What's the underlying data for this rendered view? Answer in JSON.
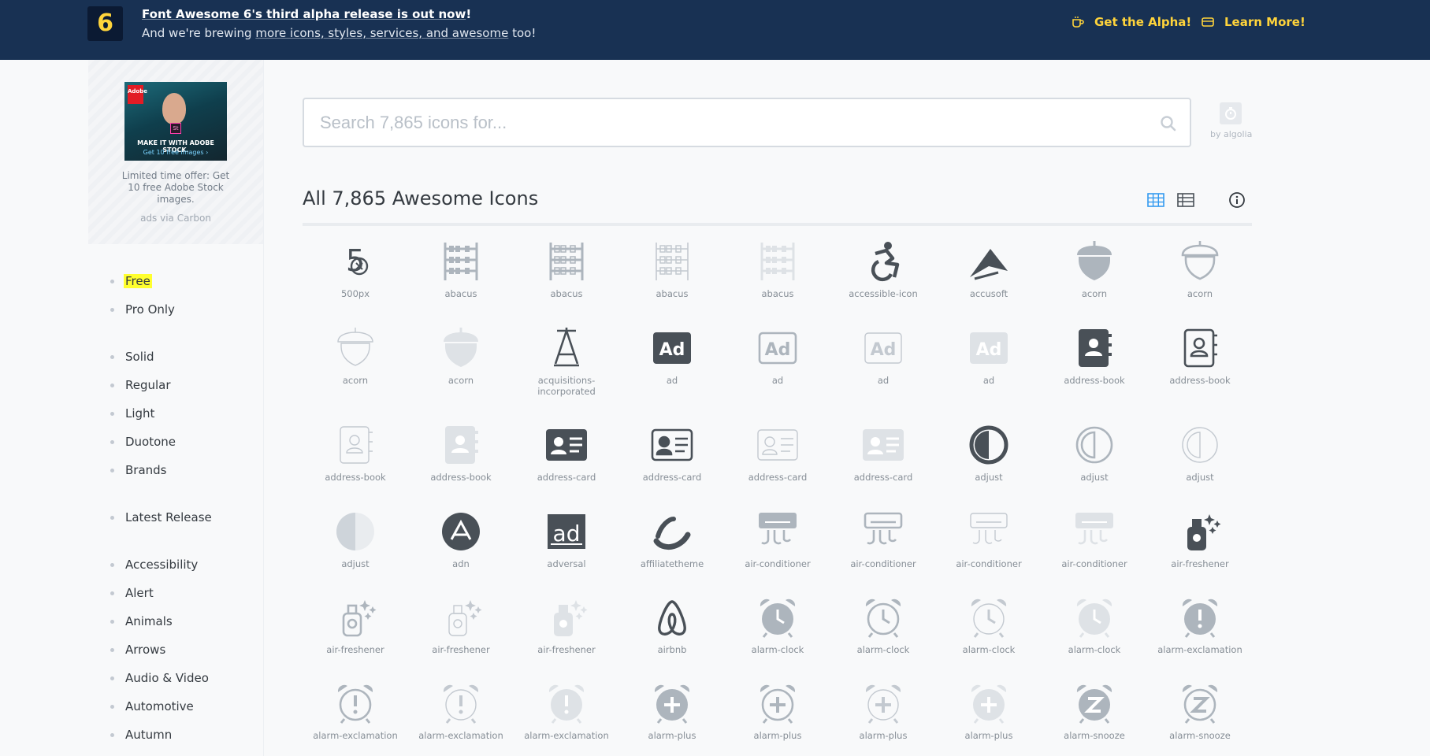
{
  "banner": {
    "logo": "6",
    "headline_link": "Font Awesome 6's third alpha release is out now",
    "headline_end": "!",
    "sub_before": "And we're brewing ",
    "sub_link": "more icons, styles, services, and awesome",
    "sub_after": " too!",
    "get_alpha": "Get the Alpha!",
    "learn_more": "Learn More!",
    "accent": "#ffd43b",
    "bg": "#183153"
  },
  "ad": {
    "image_brand": "Adobe",
    "image_caption": "MAKE IT WITH ADOBE STOCK.",
    "image_cta": "Get 10 free images ›",
    "image_badge": "St",
    "text": "Limited time offer: Get 10 free Adobe Stock images.",
    "via": "ads via Carbon"
  },
  "filters": [
    {
      "label": "Free",
      "highlight": true
    },
    {
      "label": "Pro Only"
    },
    {
      "label": "Solid"
    },
    {
      "label": "Regular"
    },
    {
      "label": "Light"
    },
    {
      "label": "Duotone"
    },
    {
      "label": "Brands"
    },
    {
      "label": "Latest Release"
    },
    {
      "label": "Accessibility"
    },
    {
      "label": "Alert"
    },
    {
      "label": "Animals"
    },
    {
      "label": "Arrows"
    },
    {
      "label": "Audio & Video"
    },
    {
      "label": "Automotive"
    },
    {
      "label": "Autumn"
    }
  ],
  "search": {
    "placeholder": "Search 7,865 icons for...",
    "value": "",
    "algolia": "by algolia"
  },
  "heading": "All 7,865 Awesome Icons",
  "icons": [
    {
      "name": "500px",
      "shape": "fivehundred",
      "style": "brand"
    },
    {
      "name": "abacus",
      "shape": "abacus",
      "style": "solid"
    },
    {
      "name": "abacus",
      "shape": "abacus",
      "style": "regular"
    },
    {
      "name": "abacus",
      "shape": "abacus",
      "style": "light"
    },
    {
      "name": "abacus",
      "shape": "abacus",
      "style": "duotone"
    },
    {
      "name": "accessible-icon",
      "shape": "accessible",
      "style": "brand"
    },
    {
      "name": "accusoft",
      "shape": "accusoft",
      "style": "brand"
    },
    {
      "name": "acorn",
      "shape": "acorn",
      "style": "solid"
    },
    {
      "name": "acorn",
      "shape": "acorn",
      "style": "regular"
    },
    {
      "name": "acorn",
      "shape": "acorn",
      "style": "light"
    },
    {
      "name": "acorn",
      "shape": "acorn",
      "style": "duotone"
    },
    {
      "name": "acquisitions-incorporated",
      "shape": "acquisitions",
      "style": "brand"
    },
    {
      "name": "ad",
      "shape": "ad",
      "style": "brand"
    },
    {
      "name": "ad",
      "shape": "ad",
      "style": "regular"
    },
    {
      "name": "ad",
      "shape": "ad",
      "style": "light"
    },
    {
      "name": "ad",
      "shape": "ad",
      "style": "duotone"
    },
    {
      "name": "address-book",
      "shape": "addressbook",
      "style": "brand"
    },
    {
      "name": "address-book",
      "shape": "addressbook",
      "style": "regular-dark"
    },
    {
      "name": "address-book",
      "shape": "addressbook",
      "style": "light"
    },
    {
      "name": "address-book",
      "shape": "addressbook",
      "style": "duotone"
    },
    {
      "name": "address-card",
      "shape": "addresscard",
      "style": "brand"
    },
    {
      "name": "address-card",
      "shape": "addresscard",
      "style": "regular-dark"
    },
    {
      "name": "address-card",
      "shape": "addresscard",
      "style": "light"
    },
    {
      "name": "address-card",
      "shape": "addresscard",
      "style": "duotone"
    },
    {
      "name": "adjust",
      "shape": "adjust",
      "style": "brand"
    },
    {
      "name": "adjust",
      "shape": "adjust",
      "style": "regular"
    },
    {
      "name": "adjust",
      "shape": "adjust",
      "style": "light"
    },
    {
      "name": "adjust",
      "shape": "adjust",
      "style": "duotone"
    },
    {
      "name": "adn",
      "shape": "adn",
      "style": "brand"
    },
    {
      "name": "adversal",
      "shape": "adversal",
      "style": "brand"
    },
    {
      "name": "affiliatetheme",
      "shape": "affiliate",
      "style": "brand"
    },
    {
      "name": "air-conditioner",
      "shape": "aircon",
      "style": "solid"
    },
    {
      "name": "air-conditioner",
      "shape": "aircon",
      "style": "regular"
    },
    {
      "name": "air-conditioner",
      "shape": "aircon",
      "style": "light"
    },
    {
      "name": "air-conditioner",
      "shape": "aircon",
      "style": "duotone"
    },
    {
      "name": "air-freshener",
      "shape": "freshener",
      "style": "brand"
    },
    {
      "name": "air-freshener",
      "shape": "freshener",
      "style": "regular"
    },
    {
      "name": "air-freshener",
      "shape": "freshener",
      "style": "light"
    },
    {
      "name": "air-freshener",
      "shape": "freshener",
      "style": "duotone"
    },
    {
      "name": "airbnb",
      "shape": "airbnb",
      "style": "brand"
    },
    {
      "name": "alarm-clock",
      "shape": "alarm",
      "style": "solid"
    },
    {
      "name": "alarm-clock",
      "shape": "alarm",
      "style": "regular"
    },
    {
      "name": "alarm-clock",
      "shape": "alarm",
      "style": "light"
    },
    {
      "name": "alarm-clock",
      "shape": "alarm",
      "style": "duotone"
    },
    {
      "name": "alarm-exclamation",
      "shape": "alarmex",
      "style": "solid"
    },
    {
      "name": "alarm-exclamation",
      "shape": "alarmex",
      "style": "regular"
    },
    {
      "name": "alarm-exclamation",
      "shape": "alarmex",
      "style": "light"
    },
    {
      "name": "alarm-exclamation",
      "shape": "alarmex",
      "style": "duotone"
    },
    {
      "name": "alarm-plus",
      "shape": "alarmplus",
      "style": "solid"
    },
    {
      "name": "alarm-plus",
      "shape": "alarmplus",
      "style": "regular"
    },
    {
      "name": "alarm-plus",
      "shape": "alarmplus",
      "style": "light"
    },
    {
      "name": "alarm-plus",
      "shape": "alarmplus",
      "style": "duotone"
    },
    {
      "name": "alarm-snooze",
      "shape": "alarmz",
      "style": "solid"
    },
    {
      "name": "alarm-snooze",
      "shape": "alarmz",
      "style": "regular"
    }
  ],
  "colors": {
    "free": "#495057",
    "pro": "#adb5bd",
    "pro_light": "#ced4da",
    "duotone": "#dee2e6",
    "active_view": "#339af0"
  }
}
